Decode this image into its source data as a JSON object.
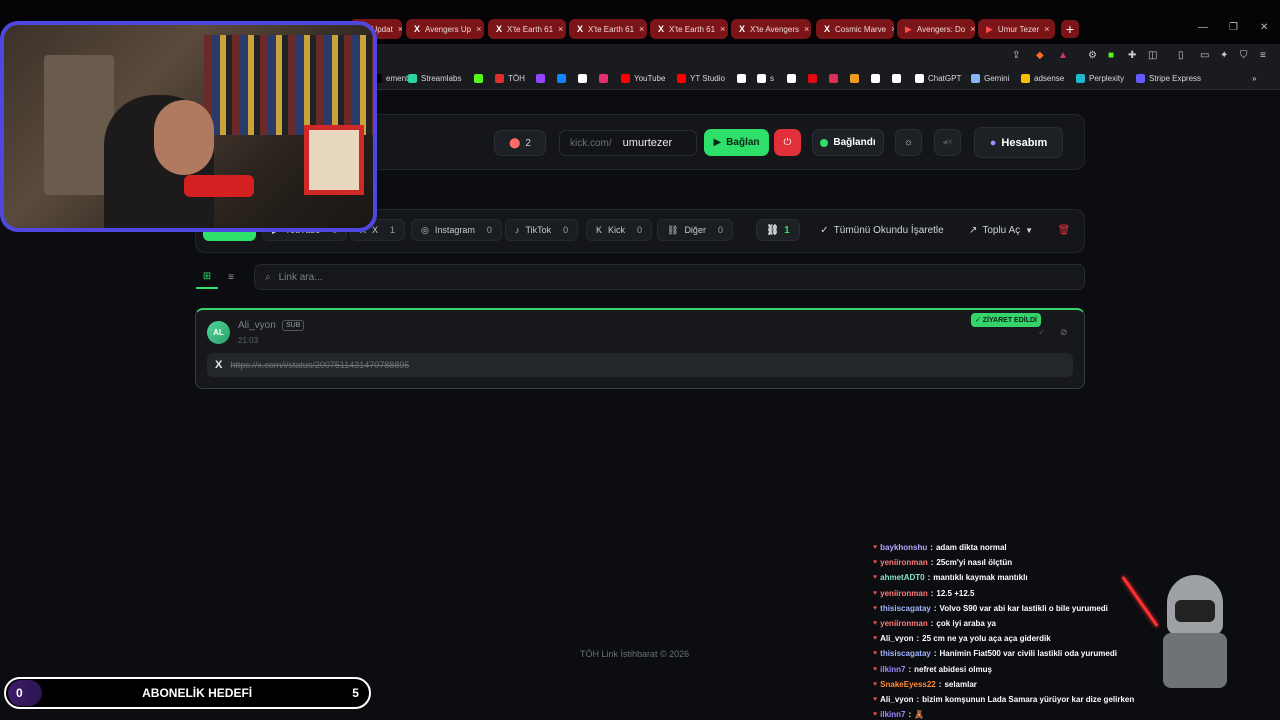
{
  "browser": {
    "tabs": [
      {
        "icon": "",
        "label": "el Updat",
        "type": "plain"
      },
      {
        "icon": "X",
        "label": "Avengers Up",
        "type": "x"
      },
      {
        "icon": "X",
        "label": "X'te Earth 61",
        "type": "x"
      },
      {
        "icon": "X",
        "label": "X'te Earth 61",
        "type": "x"
      },
      {
        "icon": "X",
        "label": "X'te Earth 61",
        "type": "x"
      },
      {
        "icon": "X",
        "label": "X'te Avengers",
        "type": "x"
      },
      {
        "icon": "X",
        "label": "Cosmic Marve",
        "type": "x"
      },
      {
        "icon": "▶",
        "label": "Avengers: Do",
        "type": "yt"
      },
      {
        "icon": "▶",
        "label": "Umur Tezer",
        "type": "yt"
      }
    ],
    "new_tab": "+",
    "bookmarks": [
      {
        "label": "ements",
        "color": "#000000"
      },
      {
        "label": "Streamlabs",
        "color": "#2bd4a0"
      },
      {
        "label": "",
        "color": "#53fc18"
      },
      {
        "label": "TÖH",
        "color": "#e02e2e"
      },
      {
        "label": "",
        "color": "#9146ff"
      },
      {
        "label": "",
        "color": "#1185fe"
      },
      {
        "label": "",
        "color": "#ffffff"
      },
      {
        "label": "",
        "color": "#e1306c"
      },
      {
        "label": "YouTube",
        "color": "#ff0000"
      },
      {
        "label": "YT Studio",
        "color": "#ff0000"
      },
      {
        "label": "",
        "color": "#ffffff"
      },
      {
        "label": "s",
        "color": "#ffffff"
      },
      {
        "label": "",
        "color": "#ffffff"
      },
      {
        "label": "",
        "color": "#e50914"
      },
      {
        "label": "",
        "color": "#e02e5a"
      },
      {
        "label": "",
        "color": "#f29c1f"
      },
      {
        "label": "",
        "color": "#ffffff"
      },
      {
        "label": "",
        "color": "#ffffff"
      },
      {
        "label": "ChatGPT",
        "color": "#ffffff"
      },
      {
        "label": "Gemini",
        "color": "#8ab4f8"
      },
      {
        "label": "adsense",
        "color": "#fbbc04"
      },
      {
        "label": "Perplexity",
        "color": "#20b8cd"
      },
      {
        "label": "Stripe Express",
        "color": "#635bff"
      }
    ]
  },
  "toolbar": {
    "count": "2",
    "url_prefix": "kick.com/",
    "channel": "umurtezer",
    "connect_label": "Bağlan",
    "status_label": "Bağlandı",
    "account_label": "Hesabım"
  },
  "filters": {
    "tabs": [
      {
        "label": "",
        "count": "",
        "icon": "",
        "active": true
      },
      {
        "label": "YouTube",
        "count": "0",
        "icon": "▶"
      },
      {
        "label": "X",
        "count": "1",
        "icon": "X"
      },
      {
        "label": "Instagram",
        "count": "0",
        "icon": "◎"
      },
      {
        "label": "TikTok",
        "count": "0",
        "icon": "♪"
      },
      {
        "label": "Kick",
        "count": "0",
        "icon": "K"
      },
      {
        "label": "Diğer",
        "count": "0",
        "icon": "⛓"
      }
    ],
    "link_count": "1",
    "mark_all_read": "Tümünü Okundu İşaretle",
    "bulk_open": "Toplu Aç"
  },
  "search": {
    "placeholder": "Link ara..."
  },
  "card": {
    "initials": "AL",
    "user": "Ali_vyon",
    "badge": "SUB",
    "time": "21:03",
    "visited_badge": "✓ ZİYARET EDİLDİ",
    "url": "https://x.com/i/status/2007511431470788895"
  },
  "footer": "TÖH Link İstihbarat © 2026",
  "chat": [
    {
      "user": "baykhonshu",
      "color": "#b9a3ff",
      "msg": "adam dikta normal"
    },
    {
      "user": "yeniironman",
      "color": "#ff7a7a",
      "msg": "25cm'yi nasıl ölçtün"
    },
    {
      "user": "ahmetADT0",
      "color": "#8be0c8",
      "msg": "mantıklı kaymak mantıklı"
    },
    {
      "user": "yeniironman",
      "color": "#ff7a7a",
      "msg": "12.5 +12.5"
    },
    {
      "user": "thisiscagatay",
      "color": "#9fb4ff",
      "msg": "Volvo S90 var abi kar lastikli o bile yurumedi"
    },
    {
      "user": "yeniironman",
      "color": "#ff7a7a",
      "msg": "çok iyi araba ya"
    },
    {
      "user": "Ali_vyon",
      "color": "#ffffff",
      "msg": "25 cm ne ya yolu aça aça giderdik"
    },
    {
      "user": "thisiscagatay",
      "color": "#9fb4ff",
      "msg": "Hanimin Fiat500 var civili lastikli oda yurumedi"
    },
    {
      "user": "ilkinn7",
      "color": "#9e8cff",
      "msg": "nefret abidesi olmuş"
    },
    {
      "user": "SnakeEyess22",
      "color": "#ff8c3a",
      "msg": "selamlar"
    },
    {
      "user": "Ali_vyon",
      "color": "#ffffff",
      "msg": "bizim komşunun Lada Samara yürüyor kar dize gelirken"
    },
    {
      "user": "ilkinn7",
      "color": "#9e8cff",
      "msg": "🧸"
    }
  ],
  "goal": {
    "start": "0",
    "label": "ABONELİK HEDEFİ",
    "target": "5",
    "progress": 0
  }
}
